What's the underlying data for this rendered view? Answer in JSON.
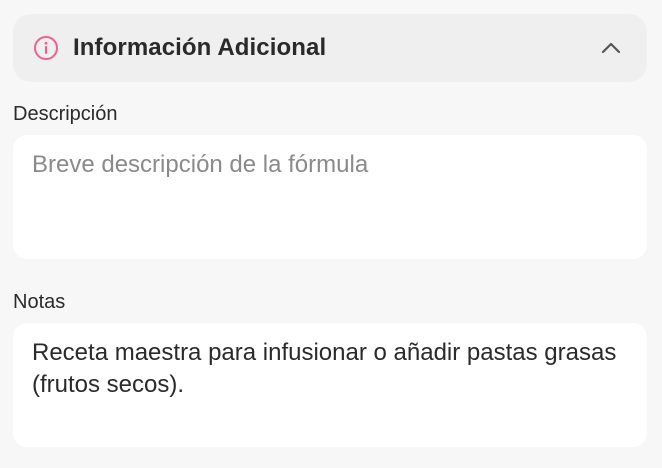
{
  "section": {
    "title": "Información Adicional",
    "icon": "info-icon",
    "collapse_icon": "chevron-up-icon",
    "accent_color": "#ef5f92"
  },
  "description": {
    "label": "Descripción",
    "value": "",
    "placeholder": "Breve descripción de la fórmula"
  },
  "notes": {
    "label": "Notas",
    "value": "Receta maestra para infusionar o añadir pastas grasas (frutos secos).",
    "placeholder": ""
  }
}
